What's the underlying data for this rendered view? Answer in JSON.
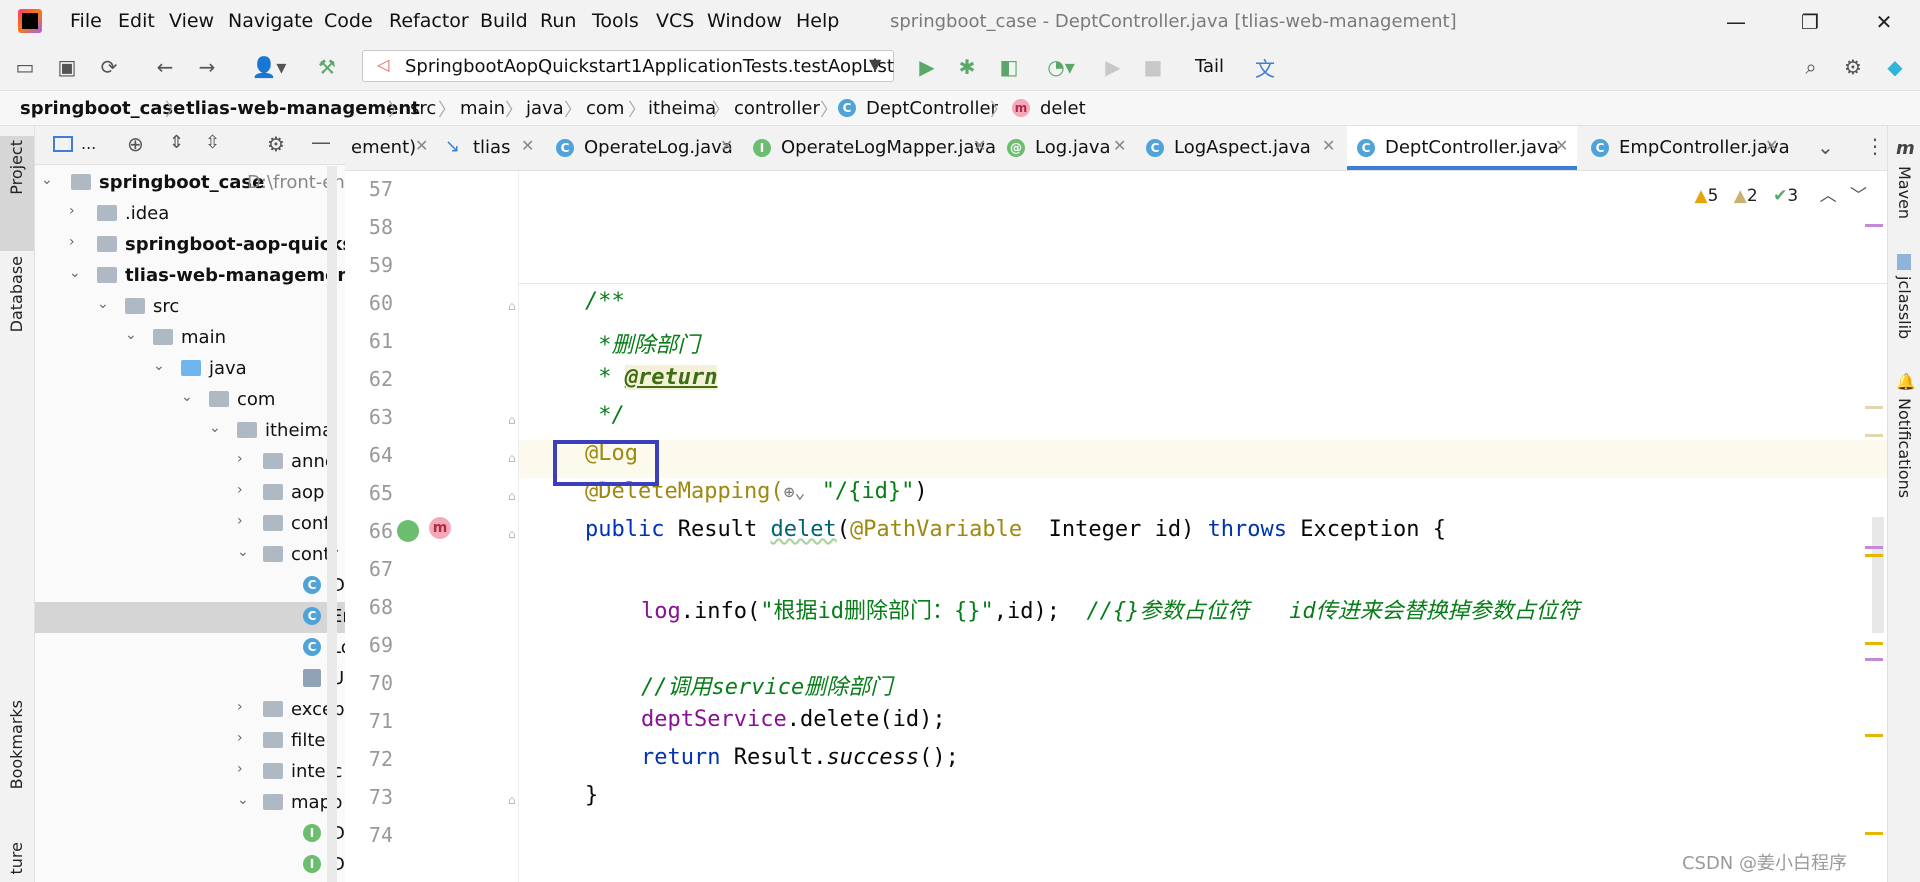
{
  "app": {
    "window_title": "springboot_case - DeptController.java [tlias-web-management]",
    "menu": [
      "File",
      "Edit",
      "View",
      "Navigate",
      "Code",
      "Refactor",
      "Build",
      "Run",
      "Tools",
      "VCS",
      "Window",
      "Help"
    ]
  },
  "toolbar": {
    "run_config": "SpringbootAopQuickstart1ApplicationTests.testAopList",
    "tail_label": "Tail"
  },
  "breadcrumb": [
    "springboot_case",
    "tlias-web-management",
    "src",
    "main",
    "java",
    "com",
    "itheima",
    "controller",
    "DeptController",
    "delet"
  ],
  "left_stripe": {
    "project": "Project",
    "database": "Database",
    "bookmarks": "Bookmarks",
    "structure": "ture"
  },
  "right_stripe": {
    "maven": "Maven",
    "jclasslib": "jclasslib",
    "notifications": "Notifications"
  },
  "project_panel": {
    "header_label": "...",
    "tree": [
      {
        "label": "springboot_case",
        "suffix": "D:\\front-end"
      },
      {
        "label": ".idea"
      },
      {
        "label": "springboot-aop-quickstar"
      },
      {
        "label": "tlias-web-management"
      },
      {
        "label": "src"
      },
      {
        "label": "main"
      },
      {
        "label": "java"
      },
      {
        "label": "com"
      },
      {
        "label": "itheima"
      },
      {
        "label": "anno"
      },
      {
        "label": "aop"
      },
      {
        "label": "confi"
      },
      {
        "label": "contr"
      },
      {
        "label": "D"
      },
      {
        "label": "Er"
      },
      {
        "label": "Lo"
      },
      {
        "label": "U"
      },
      {
        "label": "excep"
      },
      {
        "label": "filter"
      },
      {
        "label": "interc"
      },
      {
        "label": "mapp"
      },
      {
        "label": "D"
      },
      {
        "label": "D"
      }
    ]
  },
  "editor_tabs": [
    {
      "label": "ement)"
    },
    {
      "label": "tlias"
    },
    {
      "label": "OperateLog.java",
      "icon": "C"
    },
    {
      "label": "OperateLogMapper.java",
      "icon": "I"
    },
    {
      "label": "Log.java",
      "icon": "@"
    },
    {
      "label": "LogAspect.java",
      "icon": "C"
    },
    {
      "label": "DeptController.java",
      "icon": "C"
    },
    {
      "label": "EmpController.java",
      "icon": "C"
    }
  ],
  "inspections": {
    "warnings": "5",
    "weak_warnings": "2",
    "ok": "3"
  },
  "editor": {
    "line_numbers": [
      "57",
      "58",
      "59",
      "60",
      "61",
      "62",
      "63",
      "64",
      "65",
      "66",
      "67",
      "68",
      "69",
      "70",
      "71",
      "72",
      "73",
      "74"
    ],
    "code": {
      "l60": "/**",
      "l61": " *删除部门",
      "l62_star": " * ",
      "l62_tag": "@return",
      "l63": " */",
      "l64": "@Log",
      "l65_ann": "@DeleteMapping(",
      "l65_str": "\"/{id}\"",
      "l65_end": ")",
      "l66_kw": "public",
      "l66_a": " Result ",
      "l66_m": "delet",
      "l66_b": "(",
      "l66_ann": "@PathVariable",
      "l66_c": "  Integer id) ",
      "l66_kw2": "throws",
      "l66_d": " Exception {",
      "l68_fld": "log",
      "l68_a": ".info(",
      "l68_str": "\"根据id删除部门：{}\"",
      "l68_b": ",id);  ",
      "l68_cm": "//{}参数占位符   id传进来会替换掉参数占位符",
      "l70_cm": "//调用service删除部门",
      "l71_fld": "deptService",
      "l71_a": ".delete(id);",
      "l72_kw": "return",
      "l72_a": " Result.",
      "l72_m": "success",
      "l72_b": "();",
      "l73": "}"
    }
  },
  "watermark": "CSDN @姜小白程序"
}
